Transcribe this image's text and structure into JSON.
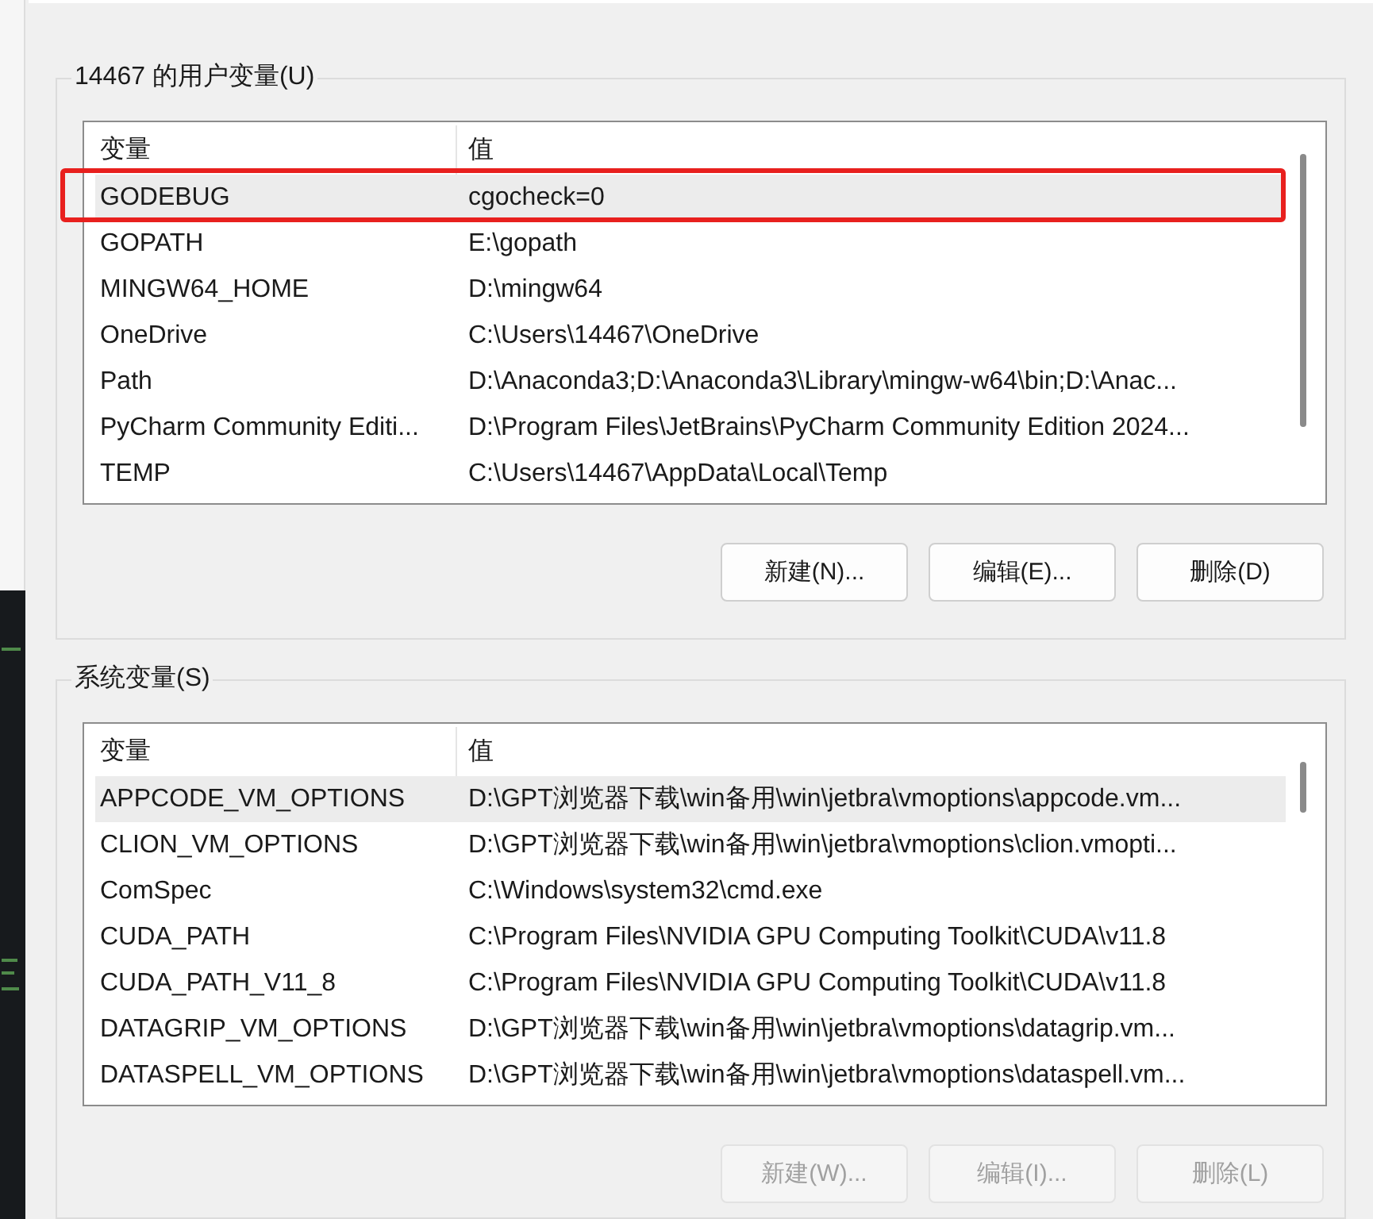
{
  "groups": [
    {
      "title": "14467 的用户变量(U)",
      "columns": [
        "变量",
        "值"
      ],
      "rows": [
        {
          "name": "GODEBUG",
          "value": "cgocheck=0",
          "selected": true,
          "highlighted": true
        },
        {
          "name": "GOPATH",
          "value": "E:\\gopath",
          "selected": false,
          "highlighted": false
        },
        {
          "name": "MINGW64_HOME",
          "value": "D:\\mingw64",
          "selected": false,
          "highlighted": false
        },
        {
          "name": "OneDrive",
          "value": "C:\\Users\\14467\\OneDrive",
          "selected": false,
          "highlighted": false
        },
        {
          "name": "Path",
          "value": "D:\\Anaconda3;D:\\Anaconda3\\Library\\mingw-w64\\bin;D:\\Anac...",
          "selected": false,
          "highlighted": false
        },
        {
          "name": "PyCharm Community Editi...",
          "value": "D:\\Program Files\\JetBrains\\PyCharm Community Edition 2024...",
          "selected": false,
          "highlighted": false
        },
        {
          "name": "TEMP",
          "value": "C:\\Users\\14467\\AppData\\Local\\Temp",
          "selected": false,
          "highlighted": false
        }
      ],
      "buttons": [
        {
          "label": "新建(N)...",
          "disabled": false
        },
        {
          "label": "编辑(E)...",
          "disabled": false
        },
        {
          "label": "删除(D)",
          "disabled": false
        }
      ]
    },
    {
      "title": "系统变量(S)",
      "columns": [
        "变量",
        "值"
      ],
      "rows": [
        {
          "name": "APPCODE_VM_OPTIONS",
          "value": "D:\\GPT浏览器下载\\win备用\\win\\jetbra\\vmoptions\\appcode.vm...",
          "selected": true,
          "highlighted": false
        },
        {
          "name": "CLION_VM_OPTIONS",
          "value": "D:\\GPT浏览器下载\\win备用\\win\\jetbra\\vmoptions\\clion.vmopti...",
          "selected": false,
          "highlighted": false
        },
        {
          "name": "ComSpec",
          "value": "C:\\Windows\\system32\\cmd.exe",
          "selected": false,
          "highlighted": false
        },
        {
          "name": "CUDA_PATH",
          "value": "C:\\Program Files\\NVIDIA GPU Computing Toolkit\\CUDA\\v11.8",
          "selected": false,
          "highlighted": false
        },
        {
          "name": "CUDA_PATH_V11_8",
          "value": "C:\\Program Files\\NVIDIA GPU Computing Toolkit\\CUDA\\v11.8",
          "selected": false,
          "highlighted": false
        },
        {
          "name": "DATAGRIP_VM_OPTIONS",
          "value": "D:\\GPT浏览器下载\\win备用\\win\\jetbra\\vmoptions\\datagrip.vm...",
          "selected": false,
          "highlighted": false
        },
        {
          "name": "DATASPELL_VM_OPTIONS",
          "value": "D:\\GPT浏览器下载\\win备用\\win\\jetbra\\vmoptions\\dataspell.vm...",
          "selected": false,
          "highlighted": false
        }
      ],
      "buttons": [
        {
          "label": "新建(W)...",
          "disabled": true
        },
        {
          "label": "编辑(I)...",
          "disabled": true
        },
        {
          "label": "删除(L)",
          "disabled": true
        }
      ]
    }
  ]
}
